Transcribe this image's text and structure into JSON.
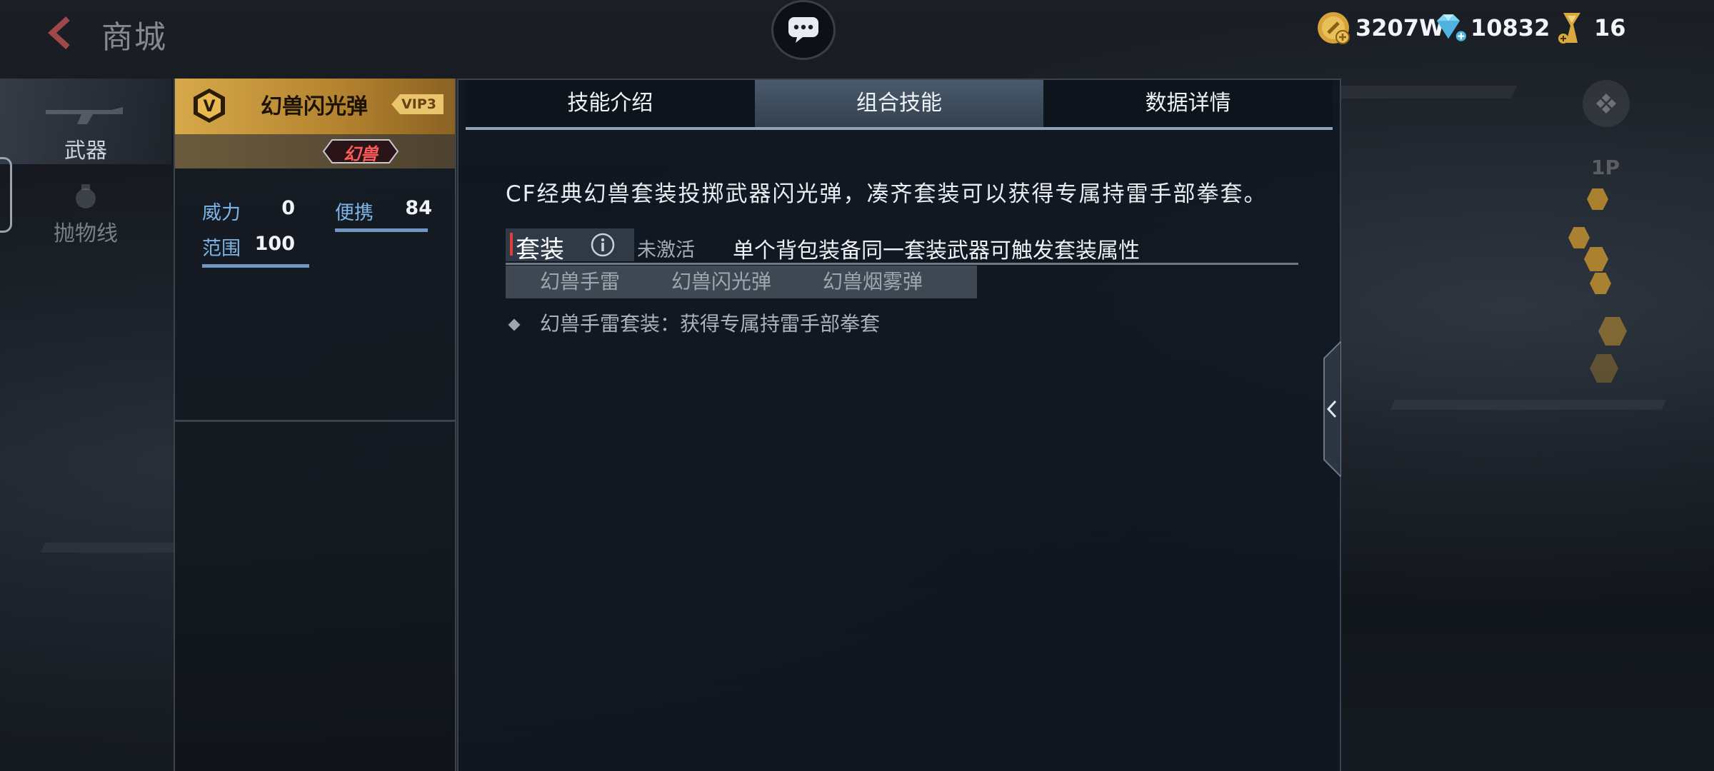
{
  "header": {
    "title": "商城",
    "currencies": [
      {
        "icon": "gold-coin-icon",
        "value": "3207W"
      },
      {
        "icon": "diamond-icon",
        "value": "10832"
      },
      {
        "icon": "ticket-icon",
        "value": "16"
      }
    ]
  },
  "nav": {
    "items": [
      {
        "label": "武器",
        "icon": "rifle-icon",
        "active": true
      },
      {
        "label": "抛物线",
        "icon": "grenade-icon",
        "active": false
      }
    ]
  },
  "weapon": {
    "name": "幻兽闪光弹",
    "vip": "VIP3",
    "series": "幻兽",
    "stats": [
      {
        "label": "威力",
        "value": "0",
        "level": 0
      },
      {
        "label": "便携",
        "value": "84",
        "level": 0.84
      },
      {
        "label": "范围",
        "value": "100",
        "level": 1.0
      }
    ]
  },
  "tabs": [
    {
      "label": "技能介绍",
      "active": false
    },
    {
      "label": "组合技能",
      "active": true
    },
    {
      "label": "数据详情",
      "active": false
    }
  ],
  "content": {
    "description": "CF经典幻兽套装投掷武器闪光弹，凑齐套装可以获得专属持雷手部拳套。",
    "set_label": "套装",
    "set_status": "未激活",
    "set_rule": "单个背包装备同一套装武器可触发套装属性",
    "members": [
      "幻兽手雷",
      "幻兽闪光弹",
      "幻兽烟雾弹"
    ],
    "bonus": "幻兽手雷套装：获得专属持雷手部拳套"
  },
  "right": {
    "player_tag": "1P"
  },
  "colors": {
    "gold_header": "#d7a94a",
    "accent_blue": "#7cb4e6",
    "active_tab": "#4a5a6d"
  }
}
